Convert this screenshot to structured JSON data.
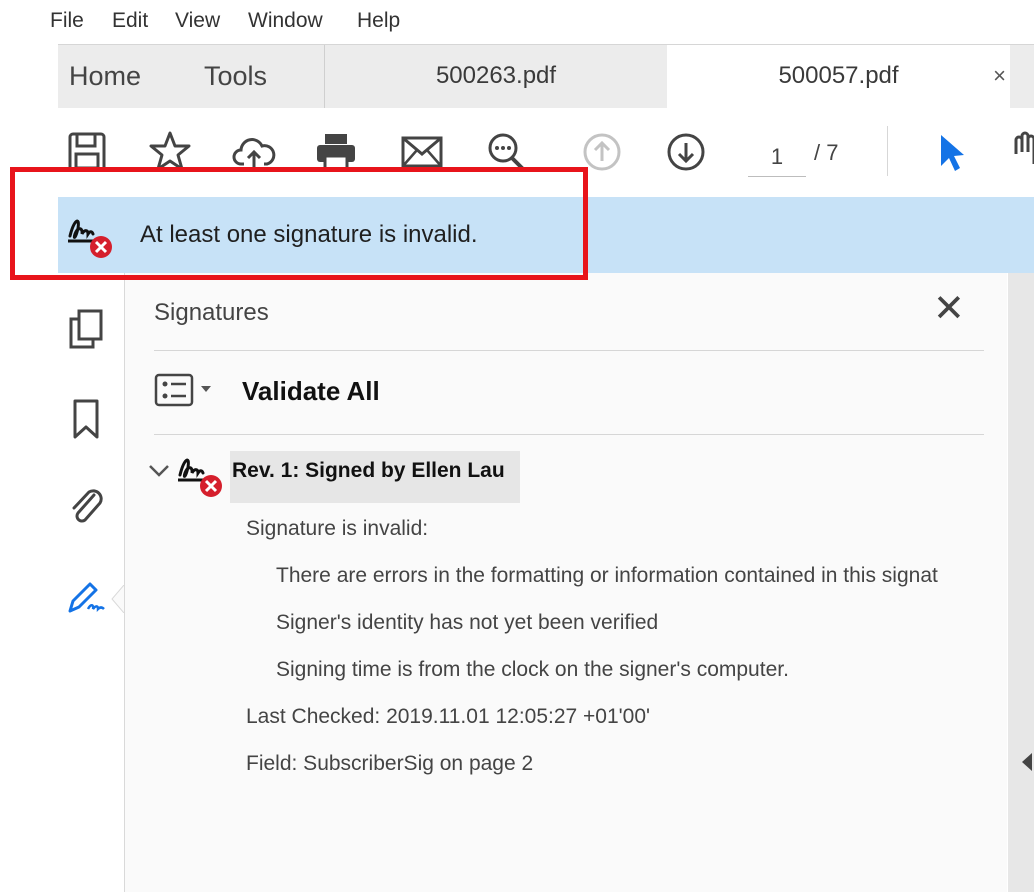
{
  "menu": [
    "File",
    "Edit",
    "View",
    "Window",
    "Help"
  ],
  "tabs": {
    "home": "Home",
    "tools": "Tools",
    "documents": [
      "500263.pdf",
      "500057.pdf"
    ],
    "close_glyph": "×"
  },
  "toolbar": {
    "page_current": "1",
    "page_total": "/ 7",
    "icons": [
      "save-icon",
      "star-icon",
      "cloud-upload-icon",
      "print-icon",
      "mail-icon",
      "zoom-icon",
      "page-up-icon",
      "page-down-icon",
      "select-arrow-icon",
      "hand-tool-icon"
    ]
  },
  "notice": {
    "text": "At least one signature is invalid.",
    "icon": "signature-invalid-icon"
  },
  "left_rail": {
    "icons": [
      "pages-icon",
      "bookmark-icon",
      "attachment-icon",
      "signature-panel-icon"
    ]
  },
  "signatures_panel": {
    "title": "Signatures",
    "close_glyph": "✕",
    "validate_all": "Validate All",
    "revision": {
      "label": "Rev. 1: Signed by Ellen Lau",
      "status": "Signature is invalid:",
      "reasons": [
        "There are errors in the formatting or information contained in this signat",
        "Signer's identity has not yet been verified",
        "Signing time is from the clock on the signer's computer."
      ],
      "last_checked": "Last Checked: 2019.11.01 12:05:27 +01'00'",
      "field": "Field: SubscriberSig on page 2"
    }
  },
  "colors": {
    "notice_bg": "#c7e2f7",
    "highlight_border": "#e8141b",
    "error_red": "#d51f2c",
    "accent_blue": "#1473e6"
  }
}
